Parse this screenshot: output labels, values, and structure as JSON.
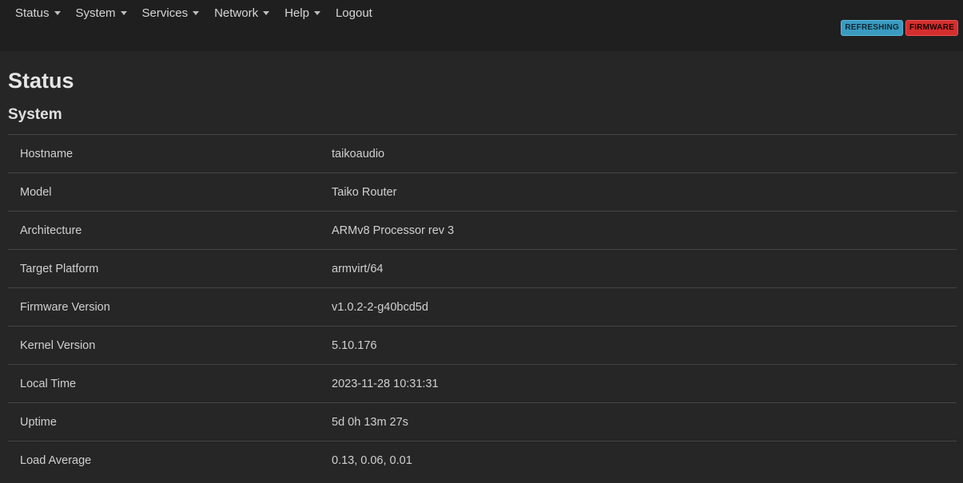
{
  "nav": {
    "items": [
      {
        "label": "Status",
        "dropdown": true
      },
      {
        "label": "System",
        "dropdown": true
      },
      {
        "label": "Services",
        "dropdown": true
      },
      {
        "label": "Network",
        "dropdown": true
      },
      {
        "label": "Help",
        "dropdown": true
      },
      {
        "label": "Logout",
        "dropdown": false
      }
    ],
    "badges": {
      "refreshing": "REFRESHING",
      "firmware": "FIRMWARE"
    }
  },
  "page": {
    "title": "Status",
    "section": "System"
  },
  "system_info": [
    {
      "label": "Hostname",
      "value": "taikoaudio"
    },
    {
      "label": "Model",
      "value": "Taiko Router"
    },
    {
      "label": "Architecture",
      "value": "ARMv8 Processor rev 3"
    },
    {
      "label": "Target Platform",
      "value": "armvirt/64"
    },
    {
      "label": "Firmware Version",
      "value": "v1.0.2-2-g40bcd5d"
    },
    {
      "label": "Kernel Version",
      "value": "5.10.176"
    },
    {
      "label": "Local Time",
      "value": "2023-11-28 10:31:31"
    },
    {
      "label": "Uptime",
      "value": "5d 0h 13m 27s"
    },
    {
      "label": "Load Average",
      "value": "0.13, 0.06, 0.01"
    }
  ],
  "colors": {
    "background": "#262626",
    "navbar": "#1f1f1f",
    "badge_refreshing": "#3a9bc0",
    "badge_firmware": "#d32f2f"
  }
}
